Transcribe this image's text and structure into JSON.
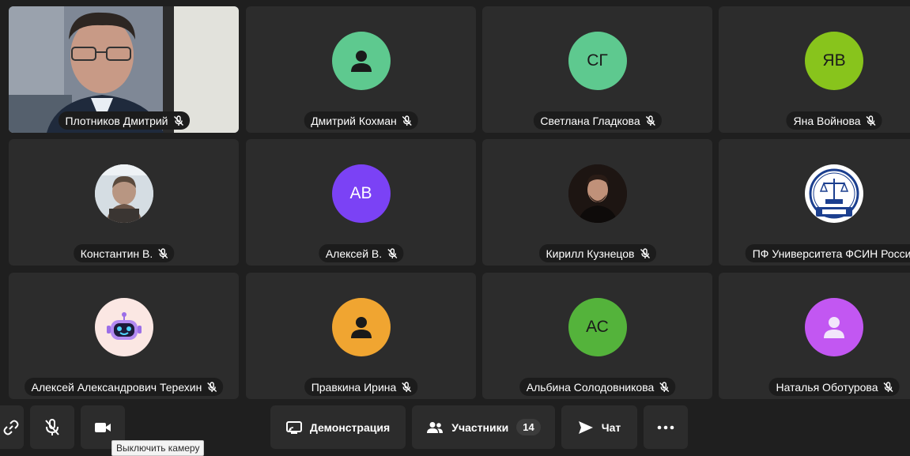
{
  "participants": [
    {
      "name": "Плотников Дмитрий",
      "avatar_type": "video"
    },
    {
      "name": "Дмитрий Кохман",
      "avatar_type": "icon",
      "icon": "person-icon",
      "color": "#5ec98f"
    },
    {
      "name": "Светлана Гладкова",
      "avatar_type": "initials",
      "initials": "СГ",
      "color": "#5ec98f"
    },
    {
      "name": "Яна Войнова",
      "avatar_type": "initials",
      "initials": "ЯВ",
      "color": "#88c41c"
    },
    {
      "name": "Константин В.",
      "avatar_type": "photo"
    },
    {
      "name": "Алексей В.",
      "avatar_type": "initials",
      "initials": "АВ",
      "color": "#7b42f5"
    },
    {
      "name": "Кирилл Кузнецов",
      "avatar_type": "photo"
    },
    {
      "name": "ПФ Университета ФСИН России",
      "avatar_type": "logo"
    },
    {
      "name": "Алексей Александрович Терехин",
      "avatar_type": "robot"
    },
    {
      "name": "Правкина Ирина",
      "avatar_type": "icon",
      "icon": "person-icon",
      "color": "#f0a531"
    },
    {
      "name": "Альбина Солодовникова",
      "avatar_type": "initials",
      "initials": "АС",
      "color": "#54b33b"
    },
    {
      "name": "Наталья Оботурова",
      "avatar_type": "icon",
      "icon": "person-icon",
      "color": "#c257f2"
    }
  ],
  "toolbar": {
    "link_icon": "link-icon",
    "mic_icon": "mic-off-icon",
    "camera_icon": "camera-icon",
    "share_label": "Демонстрация",
    "participants_label": "Участники",
    "participants_count": "14",
    "chat_label": "Чат",
    "more_icon": "more-icon"
  },
  "tooltip": {
    "camera": "Выключить камеру"
  }
}
